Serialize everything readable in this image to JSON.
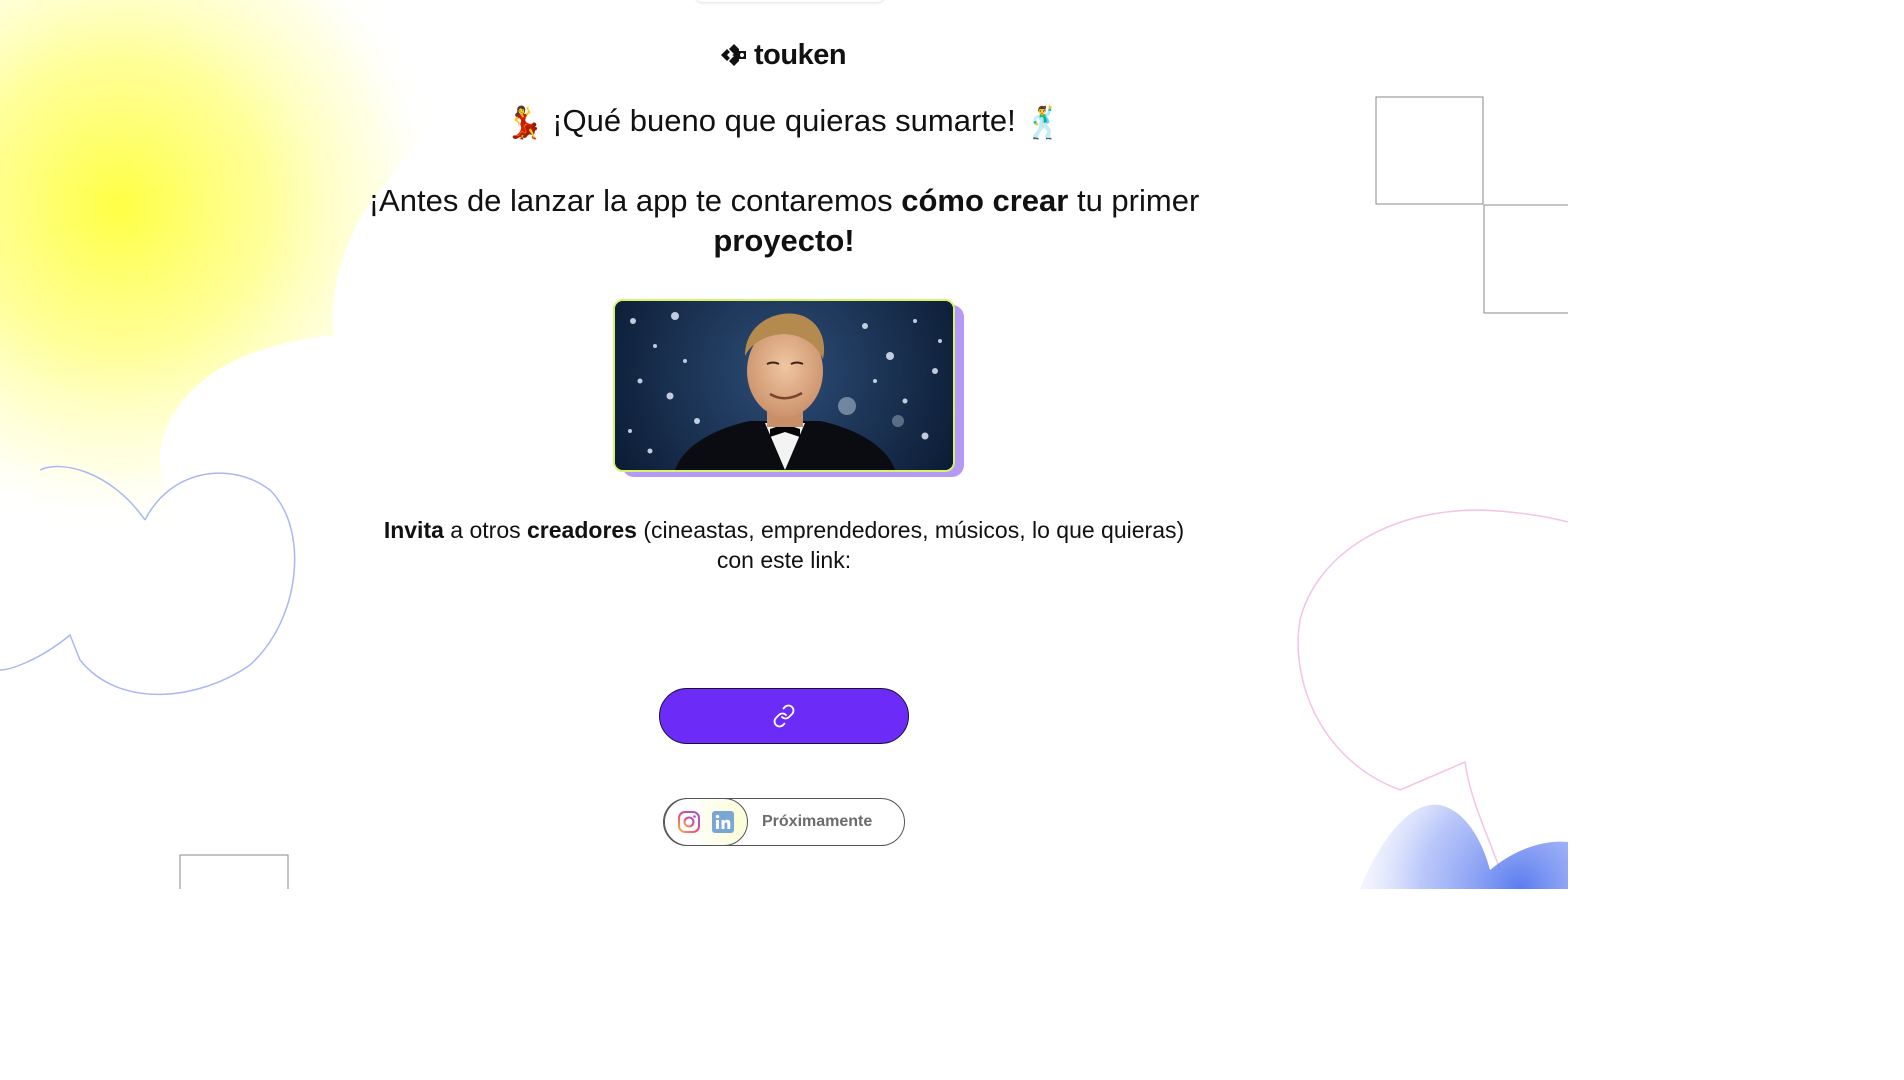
{
  "brand": {
    "name": "touken"
  },
  "greeting": {
    "emoji_left": "💃",
    "text": "¡Qué bueno que quieras sumarte!",
    "emoji_right": "🕺"
  },
  "headline": {
    "part1": "¡Antes de lanzar la app te contaremos ",
    "bold1": "cómo crear",
    "part2": " tu primer ",
    "bold2": "proyecto!"
  },
  "invite": {
    "bold1": "Invita",
    "part1": " a otros ",
    "bold2": "creadores",
    "part2": " (cineastas, emprendedores, músicos, lo que quieras) con este link:"
  },
  "link_button": {
    "icon": "link-icon"
  },
  "social": {
    "icons": [
      "instagram-icon",
      "linkedin-icon"
    ],
    "label": "Próximamente"
  },
  "colors": {
    "accent": "#6c2bf7",
    "gif_border": "#d7f26b",
    "gif_shadow": "#b59af5",
    "blob_yellow": "#ffff55"
  }
}
